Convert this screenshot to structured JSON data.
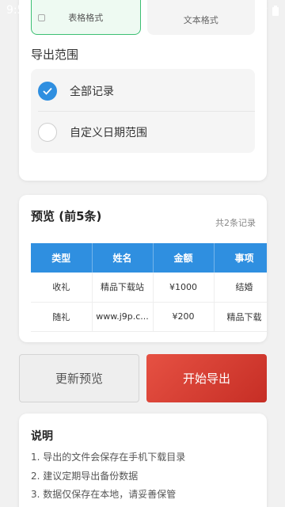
{
  "statusbar": {
    "time": "9:5",
    "icons": [
      "wifi-icon",
      "battery-icon"
    ]
  },
  "format": {
    "table_label": "表格格式",
    "text_label": "文本格式",
    "selected": "table"
  },
  "range": {
    "title": "导出范围",
    "options": [
      {
        "label": "全部记录",
        "checked": true
      },
      {
        "label": "自定义日期范围",
        "checked": false
      }
    ]
  },
  "preview": {
    "title": "预览 (前5条)",
    "count": "共2条记录",
    "columns": [
      "类型",
      "姓名",
      "金额",
      "事项"
    ],
    "rows": [
      [
        "收礼",
        "精品下载站",
        "¥1000",
        "结婚"
      ],
      [
        "随礼",
        "www.j9p.c...",
        "¥200",
        "精品下载"
      ]
    ]
  },
  "actions": {
    "refresh_label": "更新预览",
    "export_label": "开始导出"
  },
  "notes": {
    "title": "说明",
    "items": [
      "1. 导出的文件会保存在手机下载目录",
      "2. 建议定期导出备份数据",
      "3. 数据仅保存在本地，请妥善保管"
    ]
  },
  "colors": {
    "accent": "#2f8fe0",
    "export": "#d63c31",
    "selected_border": "#3cbf73"
  }
}
